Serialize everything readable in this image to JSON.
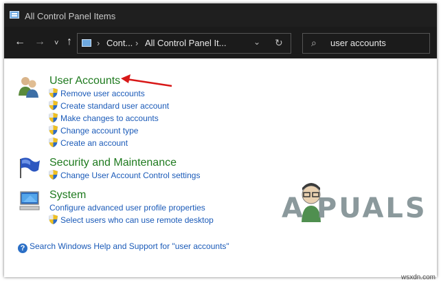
{
  "window": {
    "title": "All Control Panel Items"
  },
  "nav": {
    "back_glyph": "←",
    "forward_glyph": "→",
    "recent_glyph": "˅",
    "up_glyph": "↑"
  },
  "address": {
    "crumbs": [
      "Cont...",
      "All Control Panel It..."
    ],
    "separator": "›",
    "dropdown_glyph": "⌄",
    "refresh_glyph": "↻"
  },
  "search": {
    "value": "user accounts",
    "icon_glyph": "⌕"
  },
  "categories": [
    {
      "title": "User Accounts",
      "icon": "users-icon",
      "links": [
        {
          "label": "Remove user accounts",
          "shield": true
        },
        {
          "label": "Create standard user account",
          "shield": true
        },
        {
          "label": "Make changes to accounts",
          "shield": true
        },
        {
          "label": "Change account type",
          "shield": true
        },
        {
          "label": "Create an account",
          "shield": true
        }
      ]
    },
    {
      "title": "Security and Maintenance",
      "icon": "flag-icon",
      "links": [
        {
          "label": "Change User Account Control settings",
          "shield": true
        }
      ]
    },
    {
      "title": "System",
      "icon": "computer-icon",
      "links": [
        {
          "label": "Configure advanced user profile properties",
          "shield": false
        },
        {
          "label": "Select users who can use remote desktop",
          "shield": true
        }
      ]
    }
  ],
  "help": {
    "label": "Search Windows Help and Support for \"user accounts\"",
    "icon_glyph": "?"
  },
  "watermark": {
    "text": "A  PUALS"
  },
  "site": "wsxdn.com",
  "colors": {
    "category_title": "#1e7a1e",
    "link": "#1a5ab8",
    "annotation_arrow": "#d81818",
    "titlebar_bg": "#1f1f1f"
  }
}
